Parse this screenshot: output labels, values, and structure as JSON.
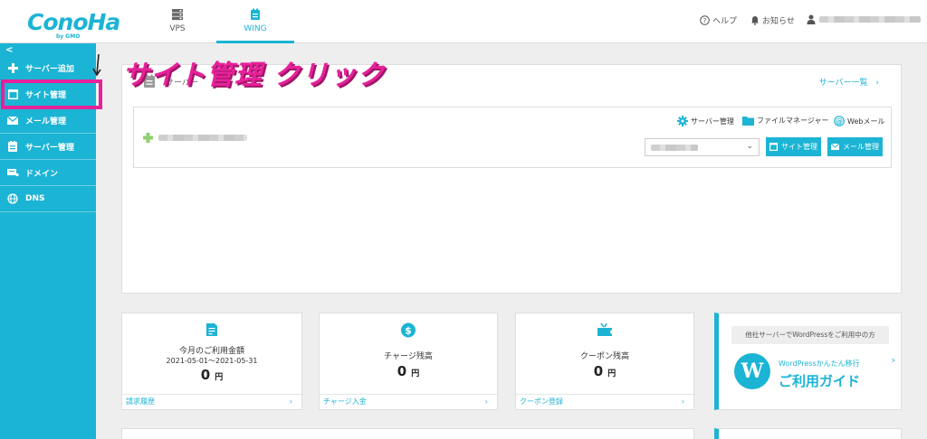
{
  "colors": {
    "accent": "#1cb4d4",
    "annotation": "#e6219a",
    "sidebar_bg": "#1cb4d4"
  },
  "header": {
    "logo_text": "ConoHa",
    "logo_sub": "by GMO",
    "tabs": [
      {
        "label": "VPS",
        "icon": "server-icon"
      },
      {
        "label": "WING",
        "icon": "wing-icon",
        "active": true
      }
    ],
    "help_label": "ヘルプ",
    "notice_label": "お知らせ"
  },
  "sidebar": {
    "collapse_glyph": "<",
    "items": [
      {
        "label": "サーバー追加",
        "icon": "plus-icon"
      },
      {
        "label": "サイト管理",
        "icon": "window-icon"
      },
      {
        "label": "メール管理",
        "icon": "mail-icon"
      },
      {
        "label": "サーバー管理",
        "icon": "server-manage-icon"
      },
      {
        "label": "ドメイン",
        "icon": "domain-icon"
      },
      {
        "label": "DNS",
        "icon": "globe-icon"
      }
    ]
  },
  "annotation": {
    "text": "サイト管理 クリック",
    "arrow": "↓"
  },
  "server_panel": {
    "title": "サーバー",
    "list_link": "サーバー一覧",
    "links": [
      "サーバー管理",
      "ファイルマネージャー",
      "Webメール"
    ],
    "buttons": {
      "site": "サイト管理",
      "mail": "メール管理"
    },
    "select_chevron": "⌄"
  },
  "stats": [
    {
      "title": "今月のご利用金額",
      "period": "2021-05-01～2021-05-31",
      "value": "0",
      "unit": "円",
      "link": "請求履歴",
      "icon": "invoice-icon"
    },
    {
      "title": "チャージ残高",
      "value": "0",
      "unit": "円",
      "link": "チャージ入金",
      "icon": "dollar-coin-icon"
    },
    {
      "title": "クーポン残高",
      "value": "0",
      "unit": "円",
      "link": "クーポン登録",
      "icon": "coupon-icon"
    }
  ],
  "wp_promo": {
    "top": "他社サーバーでWordPressをご利用中の方",
    "sub": "WordPressかんたん移行",
    "main": "ご利用ガイド",
    "logo_letter": "W"
  },
  "arrow_glyph": "›"
}
